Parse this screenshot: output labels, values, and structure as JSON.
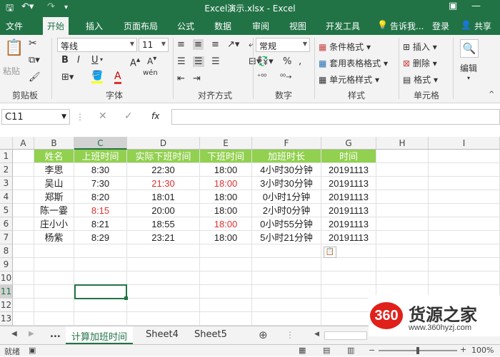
{
  "window": {
    "title": "Excel演示.xlsx - Excel"
  },
  "ribbon_tabs": [
    "文件",
    "开始",
    "插入",
    "页面布局",
    "公式",
    "数据",
    "审阅",
    "视图",
    "开发工具"
  ],
  "ribbon_right": {
    "tell_me": "告诉我...",
    "login": "登录",
    "share": "共享"
  },
  "ribbon": {
    "clipboard": {
      "paste": "粘贴",
      "label": "剪贴板"
    },
    "font": {
      "name": "等线",
      "size": "11",
      "bold": "B",
      "italic": "I",
      "underline": "U",
      "wen": "wén",
      "label": "字体"
    },
    "alignment": {
      "label": "对齐方式"
    },
    "number": {
      "format": "常规",
      "percent": "%",
      "label": "数字"
    },
    "styles": {
      "conditional": "条件格式",
      "table": "套用表格格式",
      "cell": "单元格样式",
      "label": "样式"
    },
    "cells": {
      "insert": "插入",
      "delete": "删除",
      "format": "格式",
      "label": "单元格"
    },
    "editing": {
      "label": "编辑"
    }
  },
  "formula_bar": {
    "name_box": "C11",
    "fx": "fx"
  },
  "columns": [
    "A",
    "B",
    "C",
    "D",
    "E",
    "F",
    "G",
    "H",
    "I"
  ],
  "rows": [
    "1",
    "2",
    "3",
    "4",
    "5",
    "6",
    "7",
    "8",
    "9",
    "10",
    "11",
    "12",
    "13"
  ],
  "table": {
    "headers": [
      "姓名",
      "上班时间",
      "实际下班时间",
      "下班时间",
      "加班时长",
      "时间"
    ],
    "rows": [
      [
        "李思",
        "8:30",
        "22:30",
        "18:00",
        "4小时30分钟",
        "20191113"
      ],
      [
        "吴山",
        "7:30",
        "21:30",
        "18:00",
        "3小时30分钟",
        "20191113"
      ],
      [
        "郑斯",
        "8:20",
        "18:01",
        "18:00",
        "0小时1分钟",
        "20191113"
      ],
      [
        "陈一霎",
        "8:15",
        "20:00",
        "18:00",
        "2小时0分钟",
        "20191113"
      ],
      [
        "庄小小",
        "8:21",
        "18:55",
        "18:00",
        "0小时55分钟",
        "20191113"
      ],
      [
        "杨紫",
        "8:29",
        "23:21",
        "18:00",
        "5小时21分钟",
        "20191113"
      ]
    ]
  },
  "sheets": {
    "ellipsis": "...",
    "tabs": [
      "计算加班时间",
      "Sheet4",
      "Sheet5"
    ]
  },
  "status": {
    "mode": "就绪",
    "zoom": "100%"
  },
  "watermark": {
    "logo": "360",
    "brand": "货源之家",
    "url": "www.360hyzj.com"
  },
  "colors": {
    "accent": "#217346",
    "header_fill": "#92d050",
    "red_text": "#e03030"
  }
}
